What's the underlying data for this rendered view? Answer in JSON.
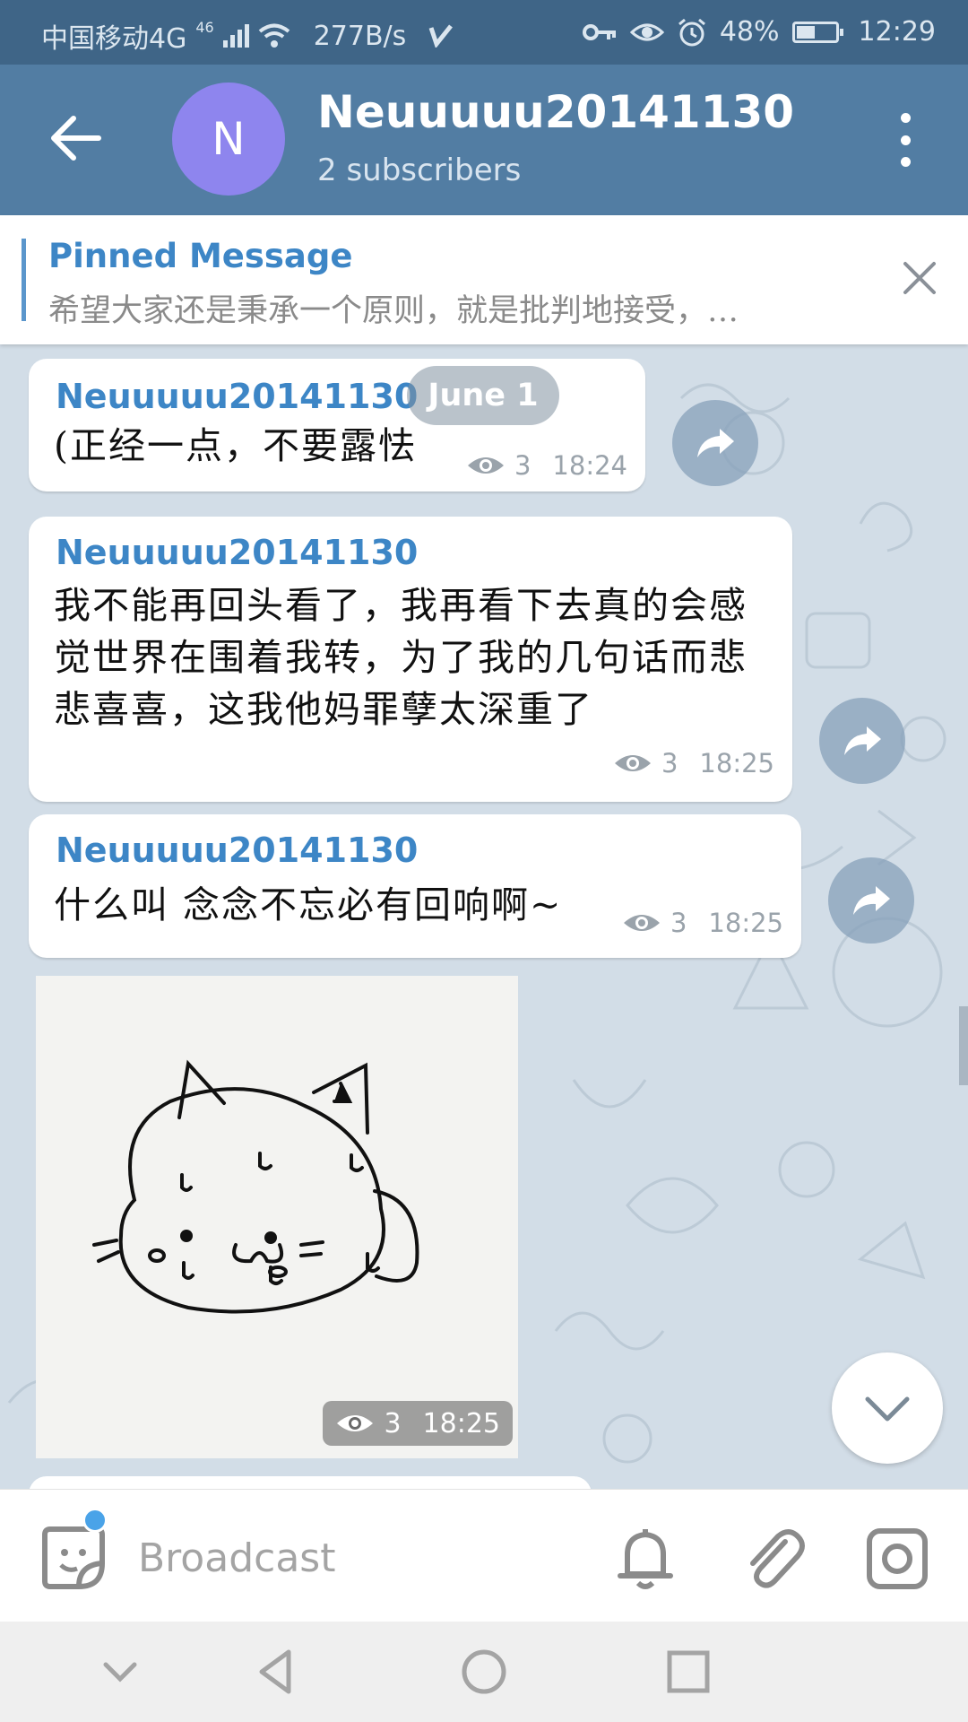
{
  "status_bar": {
    "carrier": "中国移动4G",
    "network_badge": "46",
    "speed": "277B/s",
    "battery": "48%",
    "battery_level": 0.48,
    "time": "12:29"
  },
  "header": {
    "avatar_letter": "N",
    "title": "Neuuuuu20141130",
    "subtitle": "2 subscribers",
    "avatar_color": "#8e85ee",
    "bar_color": "#527da3"
  },
  "pinned": {
    "title": "Pinned Message",
    "text": "希望大家还是秉承一个原则，就是批判地接受，…"
  },
  "messages": [
    {
      "author": "Neuuuuu20141130",
      "text": "(正经一点，不要露怯",
      "views": "3",
      "time": "18:24",
      "date_badge": "June 1"
    },
    {
      "author": "Neuuuuu20141130",
      "text": "我不能再回头看了，我再看下去真的会感觉世界在围着我转，为了我的几句话而悲悲喜喜，这我他妈罪孽太深重了",
      "views": "3",
      "time": "18:25"
    },
    {
      "author": "Neuuuuu20141130",
      "text": "什么叫 念念不忘必有回响啊~",
      "views": "3",
      "time": "18:25"
    }
  ],
  "photo_message": {
    "views": "3",
    "time": "18:25"
  },
  "composer": {
    "placeholder": "Broadcast"
  },
  "icons": {
    "back": "arrow-left",
    "menu": "more-vertical",
    "close": "x",
    "share": "share-arrow",
    "views": "eye",
    "scroll_down": "chevron-down",
    "sticker": "sticker",
    "bell": "bell",
    "attach": "paperclip",
    "camera": "instagram-camera"
  },
  "colors": {
    "accent": "#3d86c6",
    "chat_bg": "#d2dde7"
  }
}
